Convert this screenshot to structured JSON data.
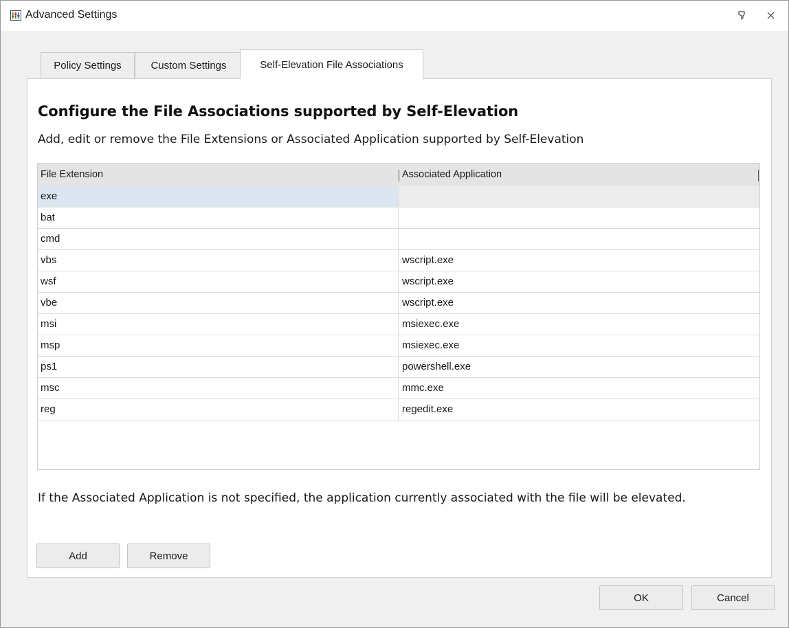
{
  "window": {
    "title": "Advanced Settings",
    "icon": "settings-sliders-icon",
    "controls": {
      "hint_icon": "pin-icon",
      "close_icon": "close-icon"
    }
  },
  "tabs": [
    {
      "label": "Policy Settings",
      "active": false
    },
    {
      "label": "Custom Settings",
      "active": false
    },
    {
      "label": "Self-Elevation File Associations",
      "active": true
    }
  ],
  "main": {
    "heading": "Configure the File Associations supported by Self-Elevation",
    "subtext": "Add, edit or remove the File Extensions or Associated Application supported by Self-Elevation",
    "table": {
      "columns": [
        "File Extension",
        "Associated Application"
      ],
      "rows": [
        {
          "ext": "exe",
          "app": ""
        },
        {
          "ext": "bat",
          "app": ""
        },
        {
          "ext": "cmd",
          "app": ""
        },
        {
          "ext": "vbs",
          "app": "wscript.exe"
        },
        {
          "ext": "wsf",
          "app": "wscript.exe"
        },
        {
          "ext": "vbe",
          "app": "wscript.exe"
        },
        {
          "ext": "msi",
          "app": "msiexec.exe"
        },
        {
          "ext": "msp",
          "app": "msiexec.exe"
        },
        {
          "ext": "ps1",
          "app": "powershell.exe"
        },
        {
          "ext": "msc",
          "app": "mmc.exe"
        },
        {
          "ext": "reg",
          "app": "regedit.exe"
        }
      ],
      "selected_row": 0
    },
    "note": "If the Associated Application is not specified, the application currently associated with the file will be elevated.",
    "add_label": "Add",
    "remove_label": "Remove"
  },
  "footer": {
    "ok_label": "OK",
    "cancel_label": "Cancel"
  },
  "colors": {
    "selection": "#dbe6f2",
    "header_bg": "#e4e4e4",
    "window_bg": "#f0f0f0"
  }
}
